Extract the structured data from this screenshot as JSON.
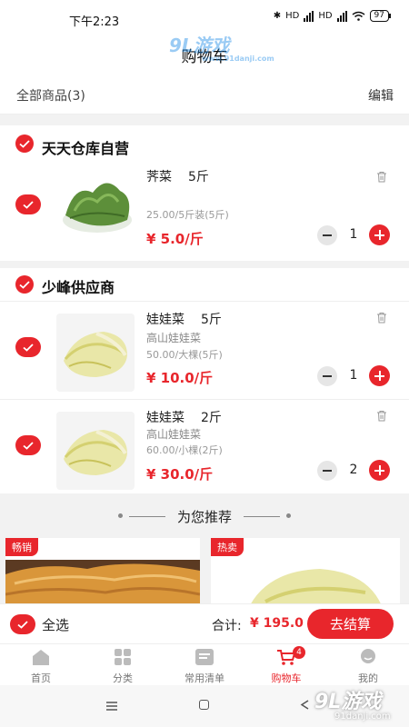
{
  "status_bar": {
    "time": "下午2:23",
    "battery": "97",
    "net1": "HD",
    "net2": "HD"
  },
  "header": {
    "title": "购物车"
  },
  "subbar": {
    "all_count": "全部商品(3)",
    "edit": "编辑"
  },
  "stores": [
    {
      "name": "天天仓库自营",
      "items": [
        {
          "name": "荠菜",
          "weight": "5斤",
          "desc": "",
          "spec": "25.00/5斤装(5斤)",
          "price": "¥ 5.0/斤",
          "qty": "1",
          "image": "leafy-greens"
        }
      ]
    },
    {
      "name": "少峰供应商",
      "items": [
        {
          "name": "娃娃菜",
          "weight": "5斤",
          "desc": "高山娃娃菜",
          "spec": "50.00/大棵(5斤)",
          "price": "¥ 10.0/斤",
          "qty": "1",
          "image": "napa-cabbage"
        },
        {
          "name": "娃娃菜",
          "weight": "2斤",
          "desc": "高山娃娃菜",
          "spec": "60.00/小棵(2斤)",
          "price": "¥ 30.0/斤",
          "qty": "2",
          "image": "napa-cabbage"
        }
      ]
    }
  ],
  "recommend": {
    "title": "为您推荐",
    "cards": [
      {
        "badge": "畅销",
        "image": "crispy-noodles"
      },
      {
        "badge": "热卖",
        "image": "napa-cabbage"
      }
    ]
  },
  "checkout": {
    "select_all": "全选",
    "total_label": "合计:",
    "total_value": "¥ 195.0",
    "button": "去结算"
  },
  "tabs": [
    {
      "label": "首页",
      "icon": "home-icon",
      "active": false
    },
    {
      "label": "分类",
      "icon": "category-icon",
      "active": false
    },
    {
      "label": "常用清单",
      "icon": "list-icon",
      "active": false
    },
    {
      "label": "购物车",
      "icon": "cart-icon",
      "active": true,
      "badge": "4"
    },
    {
      "label": "我的",
      "icon": "profile-icon",
      "active": false
    }
  ],
  "watermark": {
    "text": "9L游戏",
    "sub": "www.91danji.com"
  },
  "corner_logo": {
    "text": "9L游戏",
    "sub": "91danji.com"
  },
  "colors": {
    "accent": "#e8262c",
    "background": "#f2f2f2"
  }
}
